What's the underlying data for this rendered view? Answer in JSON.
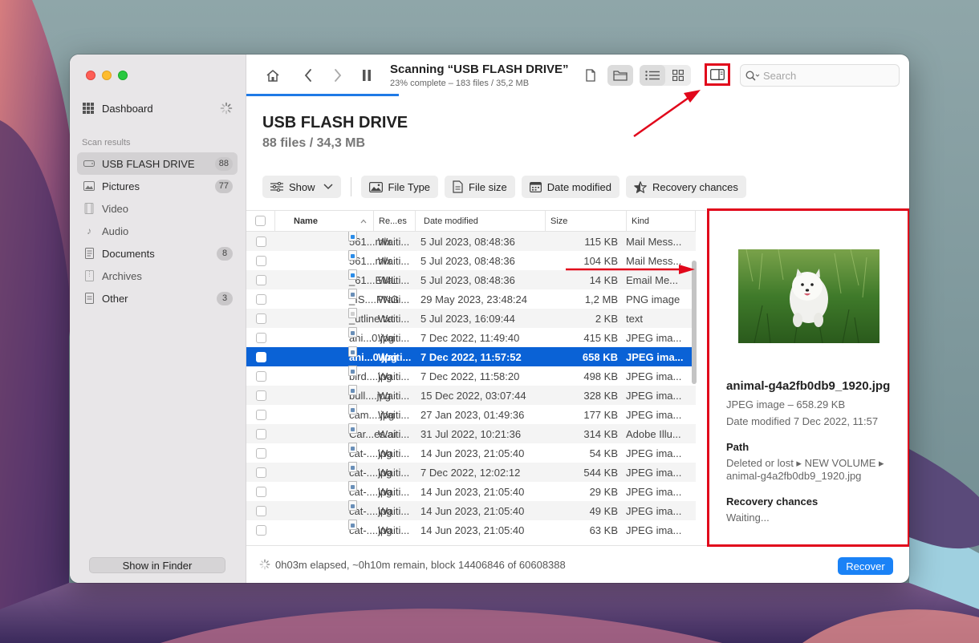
{
  "sidebar": {
    "dashboard_label": "Dashboard",
    "section_label": "Scan results",
    "items": [
      {
        "label": "USB FLASH DRIVE",
        "count": "88",
        "icon": "drive-icon"
      },
      {
        "label": "Pictures",
        "count": "77",
        "icon": "picture-icon"
      },
      {
        "label": "Video",
        "count": "",
        "icon": "film-icon"
      },
      {
        "label": "Audio",
        "count": "",
        "icon": "music-note-icon"
      },
      {
        "label": "Documents",
        "count": "8",
        "icon": "document-icon"
      },
      {
        "label": "Archives",
        "count": "",
        "icon": "archive-icon"
      },
      {
        "label": "Other",
        "count": "3",
        "icon": "file-icon"
      }
    ],
    "finder_button": "Show in Finder"
  },
  "toolbar": {
    "title": "Scanning “USB FLASH DRIVE”",
    "subtitle": "23% complete – 183 files / 35,2 MB",
    "progress_fraction": 0.23,
    "search_placeholder": "Search"
  },
  "heading": {
    "title": "USB FLASH DRIVE",
    "subtitle": "88 files / 34,3 MB"
  },
  "filters": {
    "show": "Show",
    "file_type": "File Type",
    "file_size": "File size",
    "date_modified": "Date modified",
    "recovery_chances": "Recovery chances"
  },
  "table": {
    "columns": {
      "name": "Name",
      "recovery": "Re...es",
      "date": "Date modified",
      "size": "Size",
      "kind": "Kind"
    },
    "rows": [
      {
        "name": "561...mlx",
        "rec": "Waiti...",
        "date": "5 Jul 2023, 08:48:36",
        "size": "115 KB",
        "kind": "Mail Mess...",
        "icon": "mail-icon",
        "color": "#2b8ce8",
        "selected": false
      },
      {
        "name": "561...mlx",
        "rec": "Waiti...",
        "date": "5 Jul 2023, 08:48:36",
        "size": "104 KB",
        "kind": "Mail Mess...",
        "icon": "mail-icon",
        "color": "#2b8ce8",
        "selected": false
      },
      {
        "name": "_61...EML",
        "rec": "Waiti...",
        "date": "5 Jul 2023, 08:48:36",
        "size": "14 KB",
        "kind": "Email Me...",
        "icon": "mail-icon",
        "color": "#2b8ce8",
        "selected": false
      },
      {
        "name": "_IS....PNG",
        "rec": "Waiti...",
        "date": "29 May 2023, 23:48:24",
        "size": "1,2 MB",
        "kind": "PNG image",
        "icon": "image-file-icon",
        "color": "#6a8fb8",
        "selected": false
      },
      {
        "name": "_utline.txt",
        "rec": "Waiti...",
        "date": "5 Jul 2023, 16:09:44",
        "size": "2 KB",
        "kind": "text",
        "icon": "text-file-icon",
        "color": "#cfcfcf",
        "selected": false
      },
      {
        "name": "ani...0.jpg",
        "rec": "Waiti...",
        "date": "7 Dec 2022, 11:49:40",
        "size": "415 KB",
        "kind": "JPEG ima...",
        "icon": "image-file-icon",
        "color": "#6a8fb8",
        "selected": false
      },
      {
        "name": "ani...0.jpg",
        "rec": "Waiti...",
        "date": "7 Dec 2022, 11:57:52",
        "size": "658 KB",
        "kind": "JPEG ima...",
        "icon": "image-file-icon",
        "color": "#6a8fb8",
        "selected": true
      },
      {
        "name": "bird....jpg",
        "rec": "Waiti...",
        "date": "7 Dec 2022, 11:58:20",
        "size": "498 KB",
        "kind": "JPEG ima...",
        "icon": "image-file-icon",
        "color": "#6a8fb8",
        "selected": false
      },
      {
        "name": "bull....jpg",
        "rec": "Waiti...",
        "date": "15 Dec 2022, 03:07:44",
        "size": "328 KB",
        "kind": "JPEG ima...",
        "icon": "image-file-icon",
        "color": "#6a8fb8",
        "selected": false
      },
      {
        "name": "cam....jpg",
        "rec": "Waiti...",
        "date": "27 Jan 2023, 01:49:36",
        "size": "177 KB",
        "kind": "JPEG ima...",
        "icon": "image-file-icon",
        "color": "#6a8fb8",
        "selected": false
      },
      {
        "name": "Car...es.ai",
        "rec": "Waiti...",
        "date": "31 Jul 2022, 10:21:36",
        "size": "314 KB",
        "kind": "Adobe Illu...",
        "icon": "image-file-icon",
        "color": "#6a8fb8",
        "selected": false
      },
      {
        "name": "cat-....jpg",
        "rec": "Waiti...",
        "date": "14 Jun 2023, 21:05:40",
        "size": "54 KB",
        "kind": "JPEG ima...",
        "icon": "image-file-icon",
        "color": "#6a8fb8",
        "selected": false
      },
      {
        "name": "cat-....jpg",
        "rec": "Waiti...",
        "date": "7 Dec 2022, 12:02:12",
        "size": "544 KB",
        "kind": "JPEG ima...",
        "icon": "image-file-icon",
        "color": "#6a8fb8",
        "selected": false
      },
      {
        "name": "cat-....jpg",
        "rec": "Waiti...",
        "date": "14 Jun 2023, 21:05:40",
        "size": "29 KB",
        "kind": "JPEG ima...",
        "icon": "image-file-icon",
        "color": "#6a8fb8",
        "selected": false
      },
      {
        "name": "cat-....jpg",
        "rec": "Waiti...",
        "date": "14 Jun 2023, 21:05:40",
        "size": "49 KB",
        "kind": "JPEG ima...",
        "icon": "image-file-icon",
        "color": "#6a8fb8",
        "selected": false
      },
      {
        "name": "cat-....jpg",
        "rec": "Waiti...",
        "date": "14 Jun 2023, 21:05:40",
        "size": "63 KB",
        "kind": "JPEG ima...",
        "icon": "image-file-icon",
        "color": "#6a8fb8",
        "selected": false
      }
    ]
  },
  "status": {
    "text": "0h03m elapsed, ~0h10m remain, block 14406846 of 60608388",
    "recover_button": "Recover"
  },
  "preview": {
    "file_name": "animal-g4a2fb0db9_1920.jpg",
    "meta": "JPEG image – 658.29 KB",
    "date": "Date modified 7 Dec 2022, 11:57",
    "path_heading": "Path",
    "path": "Deleted or lost ▸ NEW VOLUME ▸ animal-g4a2fb0db9_1920.jpg",
    "recovery_heading": "Recovery chances",
    "recovery_value": "Waiting..."
  },
  "colors": {
    "accent": "#1a82f6",
    "selection": "#0a62d6",
    "annotation": "#e1071b"
  }
}
